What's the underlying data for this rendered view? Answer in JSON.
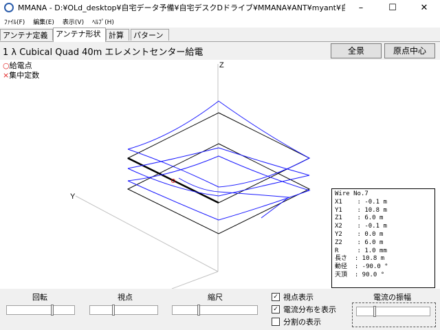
{
  "window": {
    "title": "MMANA - D:¥OLd_desktop¥自宅データ予備¥自宅デスクDドライブ¥MMANA¥ANT¥myant¥自宅アンム",
    "min_symbol": "–",
    "max_symbol": "☐",
    "close_symbol": "✕"
  },
  "menu": [
    "ﾌｧｲﾙ(F)",
    "編集(E)",
    "表示(V)",
    "ﾍﾙﾌﾟ(H)"
  ],
  "tabs": [
    {
      "label": "アンテナ定義",
      "active": false
    },
    {
      "label": "アンテナ形状",
      "active": true
    },
    {
      "label": "計算",
      "active": false
    },
    {
      "label": "パターン",
      "active": false
    }
  ],
  "header": {
    "title": "1 λ Cubical Quad 40m エレメントセンター給電",
    "btn_full": "全景",
    "btn_origin": "原点中心"
  },
  "view": {
    "axis_z": "Z",
    "axis_y": "Y",
    "legend_feed": "給電点",
    "legend_feed_mark": "○",
    "legend_load": "集中定数",
    "legend_load_mark": "×"
  },
  "wire_info": "Wire No.7\nX1    : -0.1 m\nY1    : 10.8 m\nZ1    : 6.0 m\nX2    : -0.1 m\nY2    : 0.0 m\nZ2    : 6.0 m\nR     : 1.0 mm\n長さ  : 10.8 m\n動径  : -90.0 °\n天頂  : 90.0 °",
  "controls": {
    "rotate": "回転",
    "viewpoint": "視点",
    "scale": "縮尺",
    "show_view": "視点表示",
    "show_current": "電流分布を表示",
    "show_split": "分割の表示",
    "amplitude": "電流の振幅",
    "checks": {
      "show_view": true,
      "show_current": true,
      "show_split": false
    }
  },
  "colors": {
    "wire": "#000000",
    "current": "#1a1aff",
    "feed": "#e02020",
    "axis": "#c0c0c0"
  }
}
